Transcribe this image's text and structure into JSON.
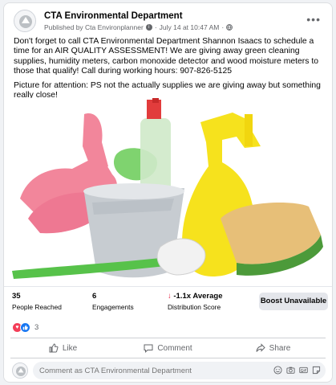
{
  "post": {
    "page_name": "CTA Environmental Department",
    "published_by": "Published by Cta Environplanner",
    "date": "July 14 at 10:47 AM",
    "more_label": "•••",
    "paragraph1": "Don't forget to call CTA Environmental Department Shannon Isaacs to schedule a time for an AIR QUALITY ASSESSMENT! We are giving away green cleaning supplies, humidity meters, carbon monoxide detector and wood moisture meters to those that qualify! Call during working hours: 907-826-5125",
    "paragraph2": "Picture for attention: PS not the actually supplies we are giving away but something really close!"
  },
  "stats": {
    "reached_value": "35",
    "reached_label": "People Reached",
    "engagements_value": "6",
    "engagements_label": "Engagements",
    "distribution_value": "-1.1x Average",
    "distribution_label": "Distribution Score",
    "boost_label": "Boost Unavailable"
  },
  "reactions": {
    "count": "3"
  },
  "actions": {
    "like": "Like",
    "comment": "Comment",
    "share": "Share"
  },
  "comment_box": {
    "placeholder": "Comment as CTA Environmental Department"
  },
  "colors": {
    "brand_blue": "#1877f2",
    "love_red": "#f33e58",
    "negative_red": "#e41e3f"
  },
  "icons": [
    "globe-icon",
    "like-icon",
    "love-icon",
    "comment-icon",
    "share-icon",
    "smiley-icon",
    "camera-icon",
    "gif-icon",
    "sticker-icon"
  ]
}
